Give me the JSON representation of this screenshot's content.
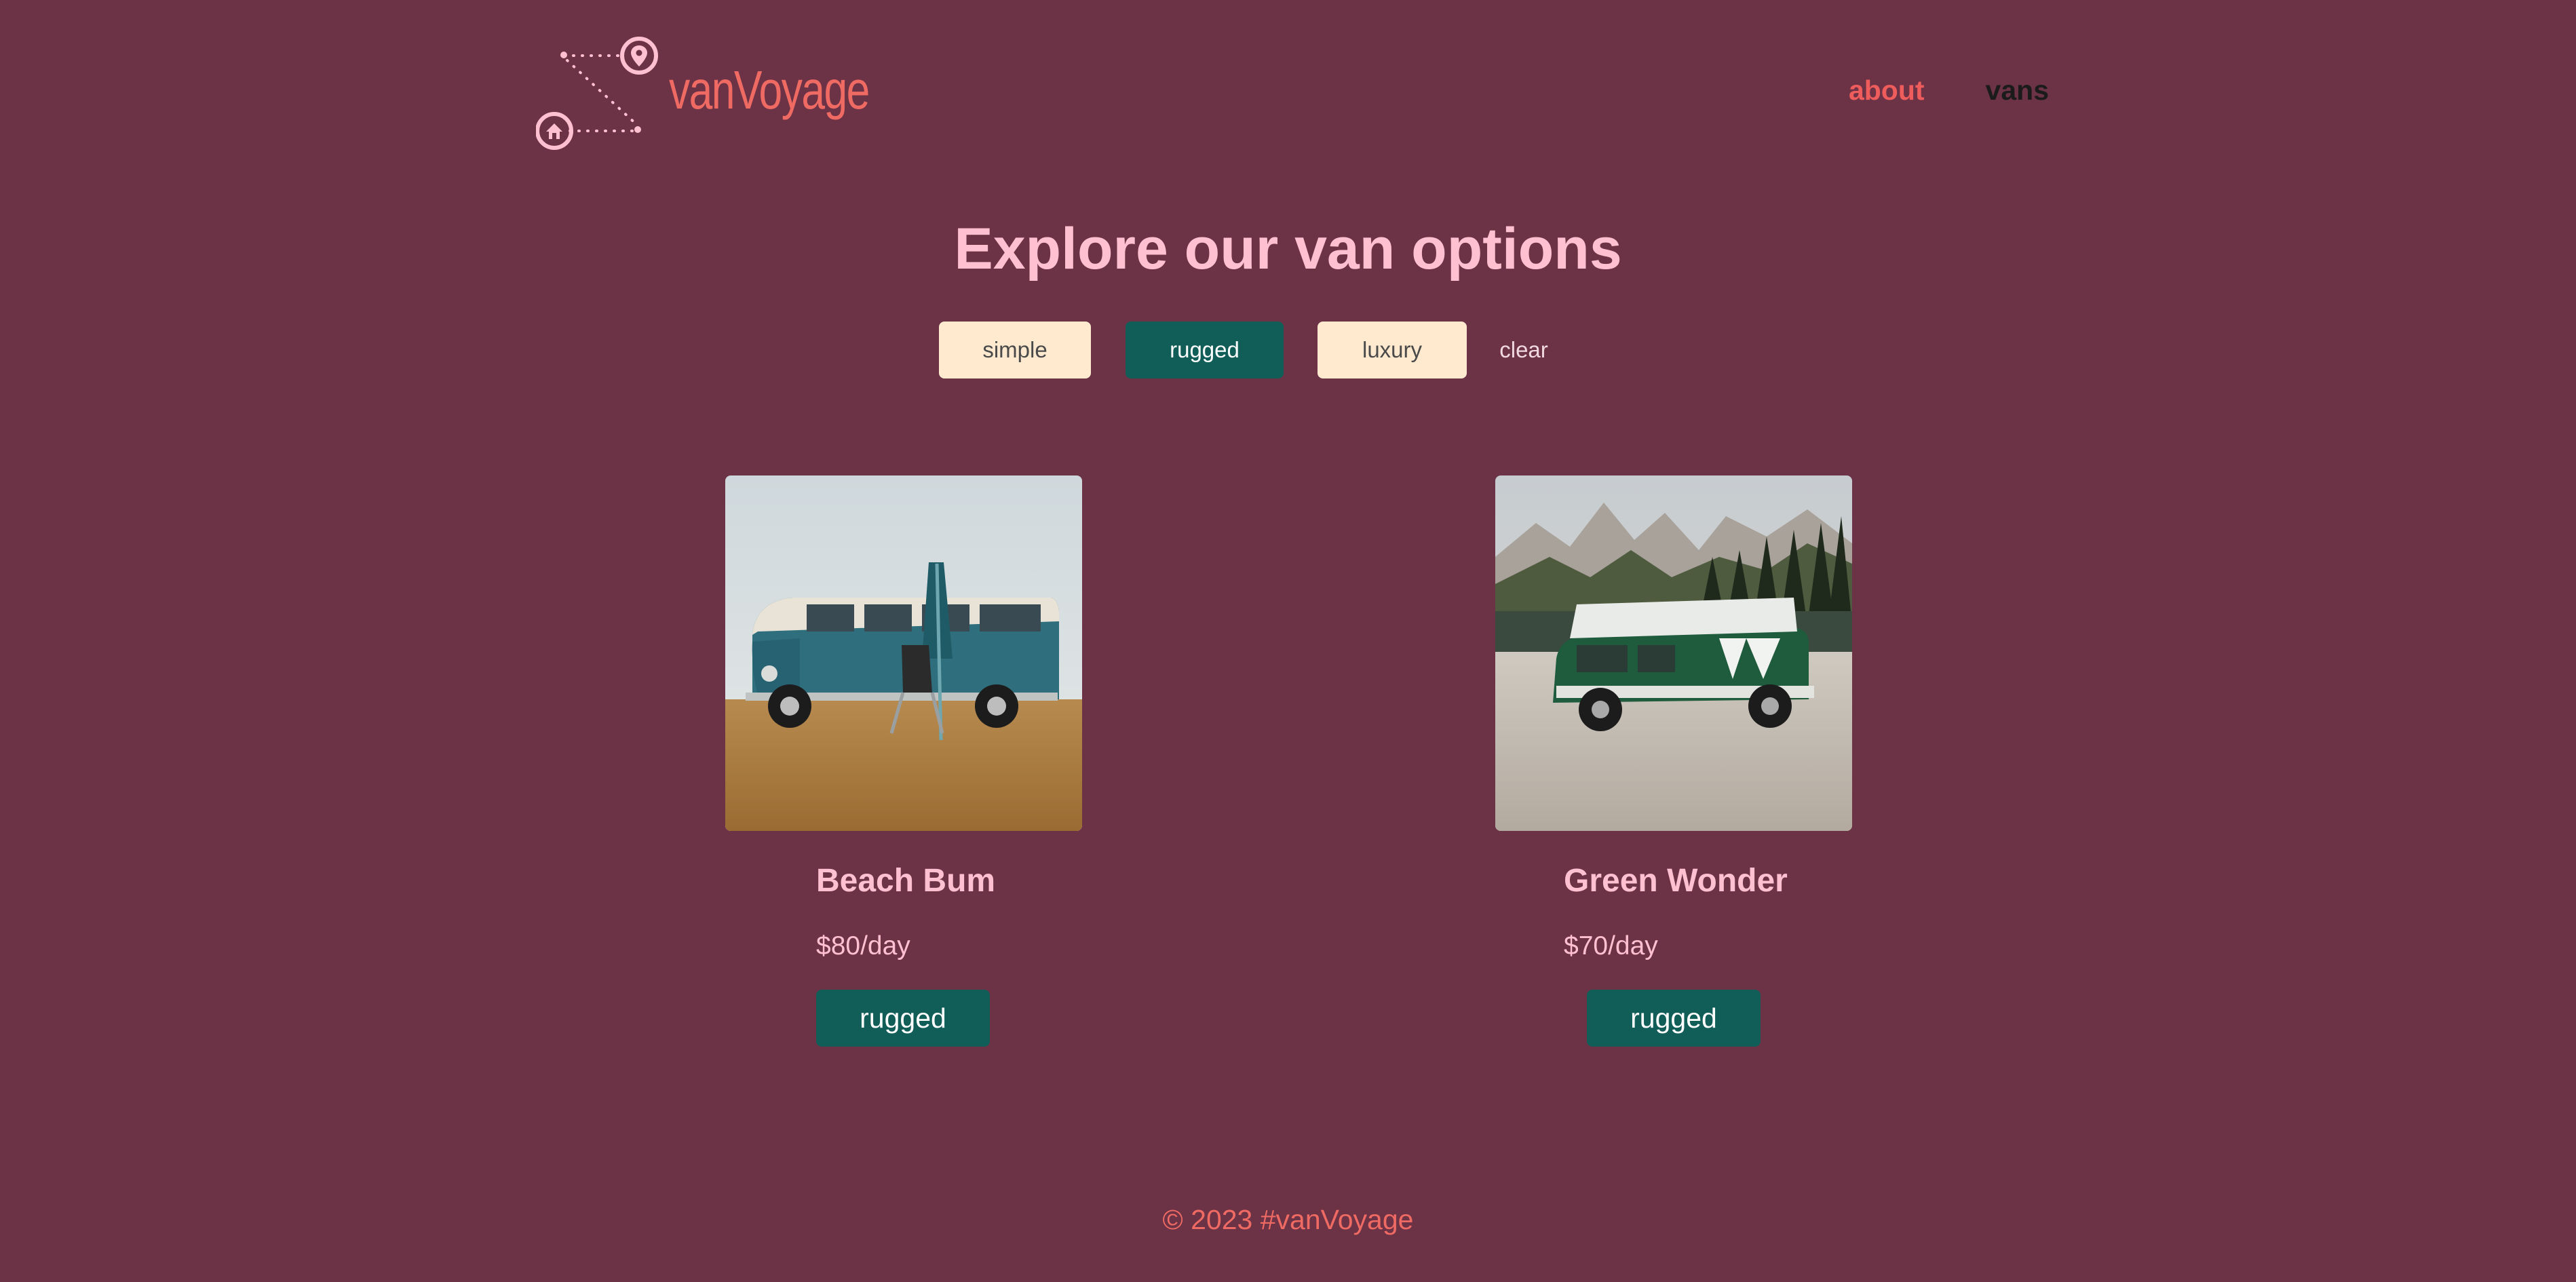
{
  "header": {
    "logo_text": "vanVoyage",
    "nav": {
      "about": "about",
      "vans": "vans"
    }
  },
  "main": {
    "title": "Explore our van options",
    "filters": {
      "simple": "simple",
      "rugged": "rugged",
      "luxury": "luxury",
      "clear": "clear"
    },
    "vans": [
      {
        "name": "Beach Bum",
        "price": "$80/day",
        "type": "rugged",
        "image": "teal-vw-bus-beach-photo"
      },
      {
        "name": "Green Wonder",
        "price": "$70/day",
        "type": "rugged",
        "image": "green-white-van-mountains-photo"
      }
    ]
  },
  "footer": {
    "text": "© 2023 #vanVoyage"
  },
  "colors": {
    "background": "#6c3246",
    "accent": "#ef6a62",
    "title_pink": "#ffc0d2",
    "rugged_green": "#115e59",
    "filter_cream": "#ffead0",
    "nav_dark": "#1b1b1b"
  }
}
